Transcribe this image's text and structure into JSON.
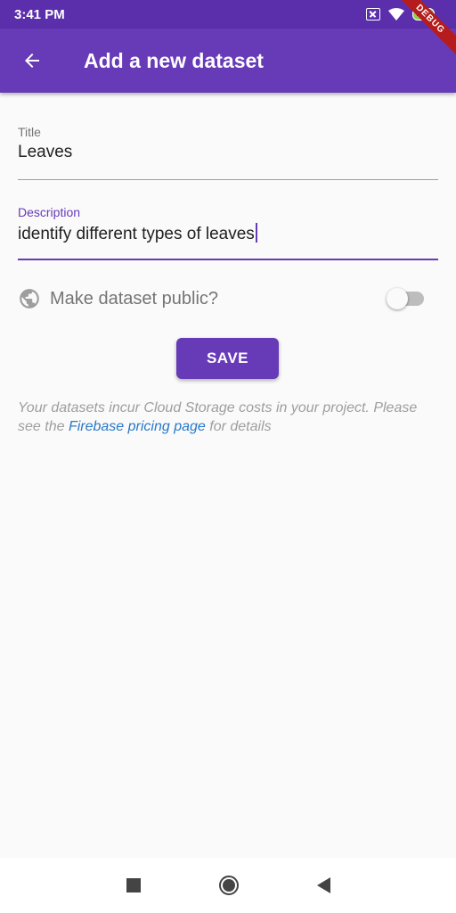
{
  "status_bar": {
    "time": "3:41 PM",
    "battery": "100"
  },
  "app_bar": {
    "title": "Add a new dataset",
    "debug_banner": "DEBUG"
  },
  "form": {
    "title_label": "Title",
    "title_value": "Leaves",
    "description_label": "Description",
    "description_value": "identify different types of leaves",
    "public_label": "Make dataset public?",
    "public_enabled": false,
    "save_label": "SAVE"
  },
  "note": {
    "text_before": "Your datasets incur Cloud Storage costs in your project. Please see the ",
    "link_text": "Firebase pricing page",
    "text_after": " for details"
  },
  "colors": {
    "primary": "#673ab7",
    "status_bar": "#5b2fab",
    "link": "#2979c8"
  },
  "icons": [
    "back-arrow-icon",
    "globe-icon",
    "wifi-icon",
    "sim-icon",
    "battery-icon"
  ]
}
